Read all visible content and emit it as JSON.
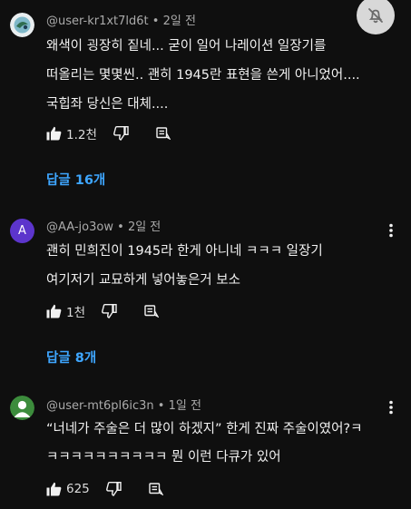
{
  "comments": [
    {
      "author": "@user-kr1xt7ld6t",
      "time": "2일 전",
      "lines": [
        "왜색이 굉장히 짙네... 굳이 일어 나레이션 일장기를",
        "떠올리는 몇몇씬.. 괜히 1945란 표현을 쓴게 아니었어....",
        "국힙좌 당신은 대체...."
      ],
      "likes": "1.2천",
      "replies_label": "답글 16개"
    },
    {
      "author": "@AA-jo3ow",
      "avatar_letter": "A",
      "time": "2일 전",
      "lines": [
        "괜히 민희진이 1945라 한게 아니네 ㅋㅋㅋ 일장기",
        "여기저기 교묘하게 넣어놓은거 보소"
      ],
      "likes": "1천",
      "replies_label": "답글 8개"
    },
    {
      "author": "@user-mt6pl6ic3n",
      "time": "1일 전",
      "lines": [
        "“너네가 주술은 더 많이 하겠지” 한게 진짜 주술이였어?ㅋ",
        "ㅋㅋㅋㅋㅋㅋㅋㅋㅋㅋ 뭔 이런 다큐가 있어"
      ],
      "likes": "625"
    }
  ],
  "separator": "•",
  "colors": {
    "background": "#0f0f0f",
    "link": "#3ea6ff",
    "avatar_purple": "#5c35cc"
  },
  "icons": {
    "like": "thumbs-up-icon",
    "dislike": "thumbs-down-icon",
    "reply": "reply-icon",
    "more": "more-vert-icon",
    "floating": "no-bell-icon"
  }
}
